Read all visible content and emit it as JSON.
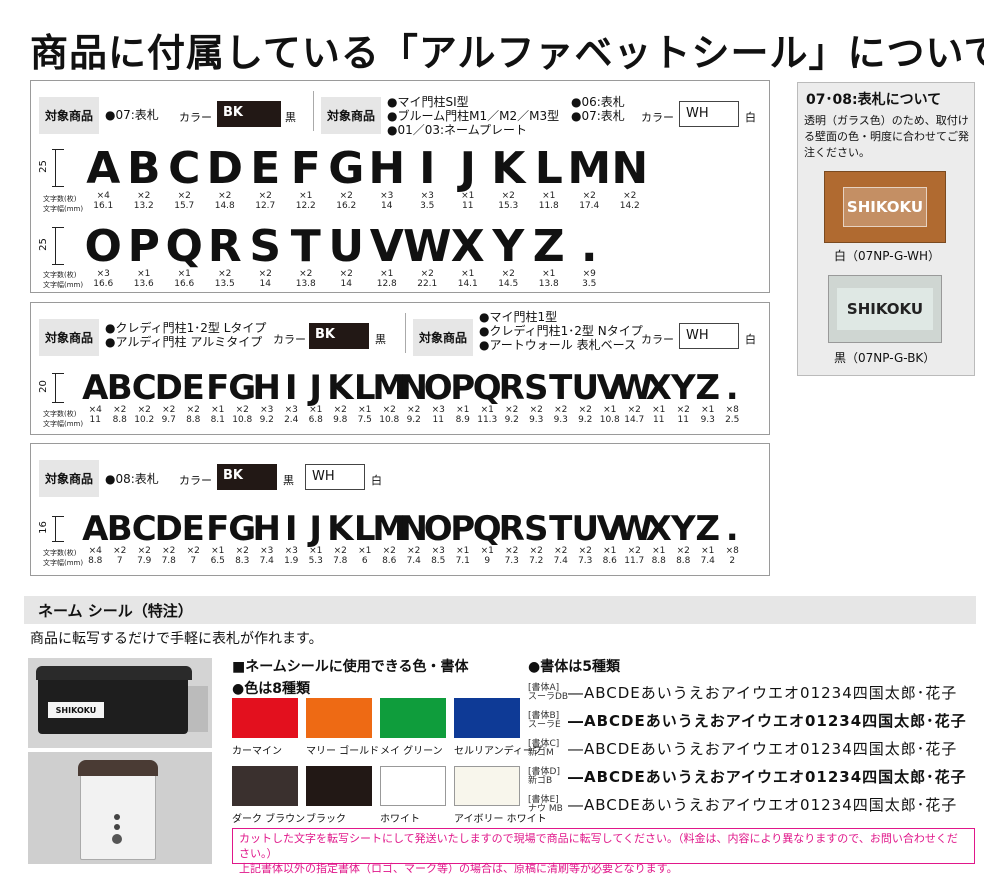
{
  "title": "商品に付属している「アルファベットシール」について",
  "labels": {
    "target": "対象商品",
    "color": "カラー",
    "count_row": "文字数(枚)",
    "width_row": "文字幅(mm)",
    "black": "黒",
    "white": "白",
    "bk": "BK",
    "wh": "WH"
  },
  "section1": {
    "left_products": [
      "●07:表札"
    ],
    "right_products": [
      "●マイ門柱SI型",
      "●ブルーム門柱M1／M2／M3型",
      "●01／03:ネームプレート"
    ],
    "right_products_b": [
      "●06:表札",
      "●07:表札"
    ],
    "height": "25",
    "row1": {
      "chars": [
        "A",
        "B",
        "C",
        "D",
        "E",
        "F",
        "G",
        "H",
        "I",
        "J",
        "K",
        "L",
        "M",
        "N"
      ],
      "counts": [
        "×4",
        "×2",
        "×2",
        "×2",
        "×2",
        "×1",
        "×2",
        "×3",
        "×3",
        "×1",
        "×2",
        "×1",
        "×2",
        "×2"
      ],
      "widths": [
        "16.1",
        "13.2",
        "15.7",
        "14.8",
        "12.7",
        "12.2",
        "16.2",
        "14",
        "3.5",
        "11",
        "15.3",
        "11.8",
        "17.4",
        "14.2"
      ]
    },
    "row2": {
      "chars": [
        "O",
        "P",
        "Q",
        "R",
        "S",
        "T",
        "U",
        "V",
        "W",
        "X",
        "Y",
        "Z",
        "."
      ],
      "counts": [
        "×3",
        "×1",
        "×1",
        "×2",
        "×2",
        "×2",
        "×2",
        "×1",
        "×2",
        "×1",
        "×2",
        "×1",
        "×9"
      ],
      "widths": [
        "16.6",
        "13.6",
        "16.6",
        "13.5",
        "14",
        "13.8",
        "14",
        "12.8",
        "22.1",
        "14.1",
        "14.5",
        "13.8",
        "3.5"
      ]
    }
  },
  "section2": {
    "left_products": [
      "●クレディ門柱1･2型 Lタイプ",
      "●アルディ門柱 アルミタイプ"
    ],
    "right_products": [
      "●マイ門柱1型",
      "●クレディ門柱1･2型 Nタイプ",
      "●アートウォール 表札ベース"
    ],
    "height": "20",
    "chars": [
      "A",
      "B",
      "C",
      "D",
      "E",
      "F",
      "G",
      "H",
      "I",
      "J",
      "K",
      "L",
      "M",
      "N",
      "O",
      "P",
      "Q",
      "R",
      "S",
      "T",
      "U",
      "V",
      "W",
      "X",
      "Y",
      "Z",
      "."
    ],
    "counts": [
      "×4",
      "×2",
      "×2",
      "×2",
      "×2",
      "×1",
      "×2",
      "×3",
      "×3",
      "×1",
      "×2",
      "×1",
      "×2",
      "×2",
      "×3",
      "×1",
      "×1",
      "×2",
      "×2",
      "×2",
      "×2",
      "×1",
      "×2",
      "×1",
      "×2",
      "×1",
      "×8"
    ],
    "widths": [
      "11",
      "8.8",
      "10.2",
      "9.7",
      "8.8",
      "8.1",
      "10.8",
      "9.2",
      "2.4",
      "6.8",
      "9.8",
      "7.5",
      "10.8",
      "9.2",
      "11",
      "8.9",
      "11.3",
      "9.2",
      "9.3",
      "9.3",
      "9.2",
      "10.8",
      "14.7",
      "11",
      "11",
      "9.3",
      "2.5"
    ]
  },
  "section3": {
    "products": [
      "●08:表札"
    ],
    "height": "16",
    "chars": [
      "A",
      "B",
      "C",
      "D",
      "E",
      "F",
      "G",
      "H",
      "I",
      "J",
      "K",
      "L",
      "M",
      "N",
      "O",
      "P",
      "Q",
      "R",
      "S",
      "T",
      "U",
      "V",
      "W",
      "X",
      "Y",
      "Z",
      "."
    ],
    "counts": [
      "×4",
      "×2",
      "×2",
      "×2",
      "×2",
      "×1",
      "×2",
      "×3",
      "×3",
      "×1",
      "×2",
      "×1",
      "×2",
      "×2",
      "×3",
      "×1",
      "×1",
      "×2",
      "×2",
      "×2",
      "×2",
      "×1",
      "×2",
      "×1",
      "×2",
      "×1",
      "×8"
    ],
    "widths": [
      "8.8",
      "7",
      "7.9",
      "7.8",
      "7",
      "6.5",
      "8.3",
      "7.4",
      "1.9",
      "5.3",
      "7.8",
      "6",
      "8.6",
      "7.4",
      "8.5",
      "7.1",
      "9",
      "7.3",
      "7.2",
      "7.4",
      "7.3",
      "8.6",
      "11.7",
      "8.8",
      "8.8",
      "7.4",
      "2"
    ]
  },
  "side": {
    "title": "07･08:表札について",
    "desc": "透明（ガラス色）のため、取付ける壁面の色・明度に合わせてご発注ください。",
    "plate_text": "SHIKOKU",
    "caption1": "白（07NP-G-WH）",
    "caption2": "黒（07NP-G-BK）"
  },
  "name_seal": {
    "heading": "ネーム シール（特注）",
    "intro": "商品に転写するだけで手軽に表札が作れます。",
    "mailbox_text": "SHIKOKU",
    "colors_heading": "■ネームシールに使用できる色・書体",
    "colors_sub": "●色は8種類",
    "fonts_sub": "●書体は5種類",
    "colors": [
      {
        "name": "カーマイン",
        "hex": "#e3101e"
      },
      {
        "name": "マリー ゴールド",
        "hex": "#ee6a14"
      },
      {
        "name": "メイ グリーン",
        "hex": "#0f9d3c"
      },
      {
        "name": "セルリアンディープ",
        "hex": "#0e3a96"
      },
      {
        "name": "ダーク ブラウン",
        "hex": "#3a302e"
      },
      {
        "name": "ブラック",
        "hex": "#221815"
      },
      {
        "name": "ホワイト",
        "hex": "#ffffff"
      },
      {
        "name": "アイボリー ホワイト",
        "hex": "#f8f6ec"
      }
    ],
    "fonts": [
      {
        "label": "[書体A]",
        "sub": "スーラDB",
        "sample": "―ABCDEあいうえおアイウエオ01234四国太郎･花子"
      },
      {
        "label": "[書体B]",
        "sub": "スーラE",
        "sample": "―ABCDEあいうえおアイウエオ01234四国太郎･花子"
      },
      {
        "label": "[書体C]",
        "sub": "新ゴM",
        "sample": "―ABCDEあいうえおアイウエオ01234四国太郎･花子"
      },
      {
        "label": "[書体D]",
        "sub": "新ゴB",
        "sample": "―ABCDEあいうえおアイウエオ01234四国太郎･花子"
      },
      {
        "label": "[書体E]",
        "sub": "ナウ MB",
        "sample": "―ABCDEあいうえおアイウエオ01234四国太郎･花子"
      }
    ],
    "note_lines": [
      "カットした文字を転写シートにして発送いたしますので現場で商品に転写してください。（料金は、内容により異なりますので、お問い合わせください。）",
      "上記書体以外の指定書体（ロゴ、マーク等）の場合は、原稿に清刷等が必要となります。"
    ]
  }
}
